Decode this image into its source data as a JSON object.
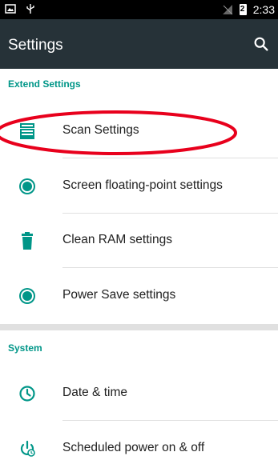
{
  "status_bar": {
    "time": "2:33",
    "battery_text": "2"
  },
  "app_bar": {
    "title": "Settings"
  },
  "sections": {
    "extend": {
      "title": "Extend Settings",
      "items": [
        {
          "label": "Scan Settings",
          "icon": "scanner-icon"
        },
        {
          "label": "Screen floating-point settings",
          "icon": "floating-button-icon"
        },
        {
          "label": "Clean RAM settings",
          "icon": "trash-icon"
        },
        {
          "label": "Power Save settings",
          "icon": "power-save-icon"
        }
      ]
    },
    "system": {
      "title": "System",
      "items": [
        {
          "label": "Date & time",
          "icon": "clock-icon"
        },
        {
          "label": "Scheduled power on & off",
          "icon": "scheduled-power-icon"
        }
      ]
    }
  },
  "colors": {
    "accent": "#009688",
    "app_bar": "#263238",
    "annotation": "#e8001c"
  }
}
